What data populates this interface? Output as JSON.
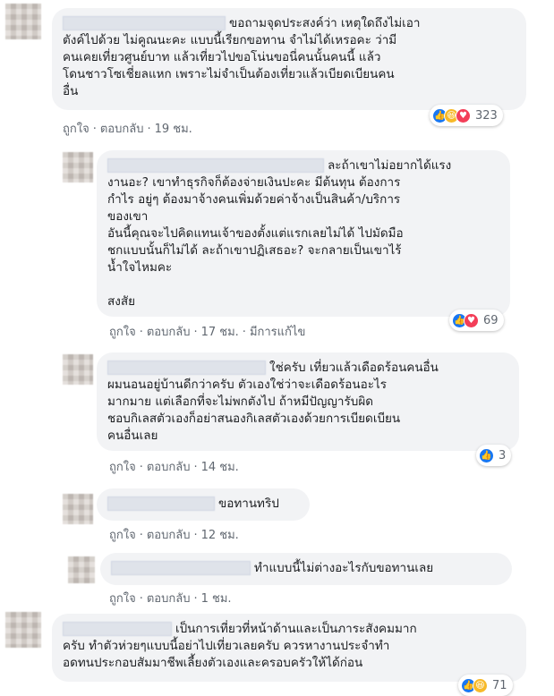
{
  "comments": [
    {
      "lines": [
        "ขอถามจุดประสงค์ว่า เหตุใดถึงไม่เอา",
        "ตังค์ไปด้วย ไม่คูณนะคะ แบบนี้เรียกขอทาน จำไม่ได้เหรอคะ ว่ามี",
        "คนเคยเที่ยวศูนย์บาท แล้วเที่ยวไปขอโน่นขอนี่คนนั้นคนนี้ แล้ว",
        "โดนชาวโซเชี่ยลแหก เพราะไม่จำเป็นต้องเที่ยวแล้วเบียดเบียนคน",
        "อื่น"
      ],
      "like_label": "ถูกใจ",
      "reply_label": "ตอบกลับ",
      "time": "19 ชม.",
      "reaction_count": "323",
      "reactions": [
        "like-icon",
        "haha-icon",
        "love-icon"
      ]
    },
    {
      "lines": [
        "ละถ้าเขาไม่อยากได้แรง",
        "งานอะ? เขาทำธุรกิจก็ต้องจ่ายเงินปะคะ มีต้นทุน ต้องการ",
        "กำไร อยู่ๆ ต้องมาจ้างคนเพิ่มด้วยค่าจ้างเป็นสินค้า/บริการ",
        "ของเขา",
        "อันนี้คุณจะไปคิดแทนเจ้าของตั้งแต่แรกเลยไม่ได้ ไปมัดมือ",
        "ชกแบบนั้นก็ไม่ได้ ละถ้าเขาปฏิเสธอะ? จะกลายเป็นเขาไร้",
        "น้ำใจไหมคะ",
        "",
        "สงสัย"
      ],
      "like_label": "ถูกใจ",
      "reply_label": "ตอบกลับ",
      "time": "17 ชม.",
      "edited": "มีการแก้ไข",
      "reaction_count": "69",
      "reactions": [
        "like-icon",
        "love-icon"
      ]
    },
    {
      "lines": [
        "ใช่ครับ เที่ยวแล้วเดือดร้อนคนอื่น",
        "ผมนอนอยู่บ้านดีกว่าครับ ตัวเองใช่ว่าจะเดือดร้อนอะไร",
        "มากมาย แต่เลือกที่จะไม่พกตังไป ถ้าหมีปัญญารับผิด",
        "ชอบกิเลสตัวเองก็อย่าสนองกิเลสตัวเองด้วยการเบียดเบียน",
        "คนอื่นเลย"
      ],
      "like_label": "ถูกใจ",
      "reply_label": "ตอบกลับ",
      "time": "14 ชม.",
      "reaction_count": "3",
      "reactions": [
        "like-icon"
      ]
    },
    {
      "lines": [
        "ขอทานทริป"
      ],
      "like_label": "ถูกใจ",
      "reply_label": "ตอบกลับ",
      "time": "12 ชม."
    },
    {
      "lines": [
        "ทำแบบนี้ไม่ต่างอะไรกับขอทานเลย"
      ],
      "like_label": "ถูกใจ",
      "reply_label": "ตอบกลับ",
      "time": "1 ชม."
    },
    {
      "lines": [
        "เป็นการเที่ยวที่หน้าด้านและเป็นภาระสังคมมาก",
        "ครับ ทำตัวห่วยๆแบบนี้อย่าไปเที่ยวเลยครับ ควรหางานประจำทำ",
        "อดทนประกอบสัมมาชีพเลี้ยงตัวเองและครอบครัวให้ได้ก่อน"
      ],
      "reaction_count": "71",
      "reactions": [
        "like-icon",
        "haha-icon"
      ]
    }
  ]
}
